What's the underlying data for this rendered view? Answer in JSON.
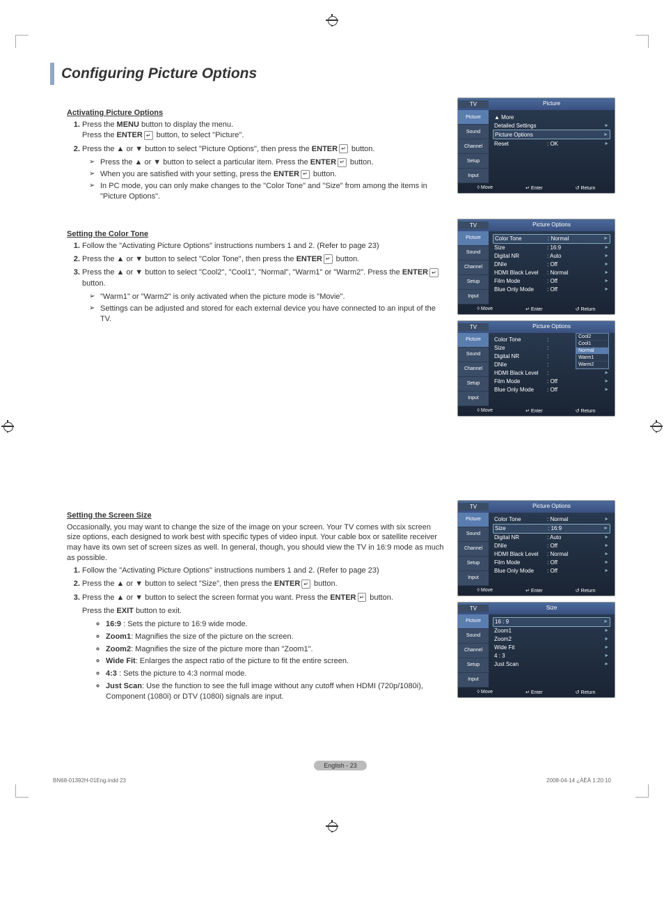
{
  "title": "Configuring Picture Options",
  "sections": {
    "s1": {
      "head": "Activating Picture Options",
      "step1a": "Press the ",
      "step1b": "MENU",
      "step1c": " button to display the menu.",
      "step1d": "Press the ",
      "step1e": "ENTER",
      "step1f": " button, to select \"Picture\".",
      "step2a": "Press the ▲ or ▼ button to select \"Picture Options\", then press the ",
      "step2b": "ENTER",
      "step2c": " button.",
      "sub1a": "Press the ▲ or ▼ button to select a particular item. Press the ",
      "sub1b": "ENTER",
      "sub1c": " button.",
      "sub2a": "When you are satisfied with your setting, press the ",
      "sub2b": "ENTER",
      "sub2c": " button.",
      "sub3": "In PC mode, you can only make changes to the \"Color Tone\" and \"Size\" from among the items in \"Picture Options\"."
    },
    "s2": {
      "head": "Setting the Color Tone",
      "step1": "Follow the \"Activating Picture Options\" instructions numbers 1 and 2. (Refer to page 23)",
      "step2a": "Press the ▲ or ▼ button to select \"Color Tone\", then press the ",
      "step2b": "ENTER",
      "step2c": " button.",
      "step3a": "Press the ▲ or ▼ button to select \"Cool2\", \"Cool1\", \"Normal\", \"Warm1\" or \"Warm2\". Press the ",
      "step3b": "ENTER",
      "step3c": " button.",
      "sub1": "\"Warm1\" or \"Warm2\" is only activated when the picture mode is \"Movie\".",
      "sub2": "Settings can be adjusted and stored for each external device you have connected to an input of the TV."
    },
    "s3": {
      "head": "Setting the Screen Size",
      "intro": "Occasionally, you may want to change the size of the image on your screen. Your TV comes with six screen size options, each designed to work best with specific types of video input. Your cable box or satellite receiver may have its own set of screen sizes as well. In general, though, you should view the TV in 16:9 mode as much as possible.",
      "step1": "Follow the \"Activating Picture Options\" instructions numbers 1 and 2. (Refer to page 23)",
      "step2a": "Press the ▲ or ▼ button to select \"Size\", then press the ",
      "step2b": "ENTER",
      "step2c": " button.",
      "step3a": "Press the ▲ or ▼ button to select the screen format you want. Press the ",
      "step3b": "ENTER",
      "step3c": " button.",
      "exit": "Press the ",
      "exitb": "EXIT",
      "exitc": " button to exit.",
      "b1": "16:9",
      "b1d": " : Sets the picture to 16:9 wide mode.",
      "b2": "Zoom1",
      "b2d": ": Magnifies the size of the picture on the screen.",
      "b3": "Zoom2",
      "b3d": ": Magnifies the size of the picture more than \"Zoom1\".",
      "b4": "Wide Fit",
      "b4d": ": Enlarges the aspect ratio of the picture to fit the entire screen.",
      "b5": "4:3",
      "b5d": " : Sets the picture to 4:3 normal mode.",
      "b6": "Just Scan",
      "b6d": ": Use the function to see the full image without any cutoff when HDMI (720p/1080i), Component (1080i) or DTV (1080i) signals are input."
    }
  },
  "osd": {
    "tv": "TV",
    "tabs": [
      "Picture",
      "Sound",
      "Channel",
      "Setup",
      "Input"
    ],
    "footer": {
      "move": "Move",
      "enter": "Enter",
      "return": "Return"
    },
    "panel1": {
      "title": "Picture",
      "more": "▲ More",
      "rows": [
        {
          "label": "Detailed Settings",
          "value": ""
        },
        {
          "label": "Picture Options",
          "value": ""
        },
        {
          "label": "Reset",
          "value": ": OK"
        }
      ]
    },
    "panel2": {
      "title": "Picture Options",
      "rows": [
        {
          "label": "Color Tone",
          "value": ": Normal"
        },
        {
          "label": "Size",
          "value": ": 16:9"
        },
        {
          "label": "Digital NR",
          "value": ": Auto"
        },
        {
          "label": "DNIe",
          "value": ": Off"
        },
        {
          "label": "HDMI Black Level",
          "value": ": Normal"
        },
        {
          "label": "Film Mode",
          "value": ": Off"
        },
        {
          "label": "Blue Only Mode",
          "value": ": Off"
        }
      ]
    },
    "panel3": {
      "title": "Picture Options",
      "rows": [
        {
          "label": "Color Tone",
          "value": ":"
        },
        {
          "label": "Size",
          "value": ":"
        },
        {
          "label": "Digital NR",
          "value": ":"
        },
        {
          "label": "DNIe",
          "value": ":"
        },
        {
          "label": "HDMI Black Level",
          "value": ":"
        },
        {
          "label": "Film Mode",
          "value": ": Off"
        },
        {
          "label": "Blue Only Mode",
          "value": ": Off"
        }
      ],
      "dropdown": [
        "Cool2",
        "Cool1",
        "Normal",
        "Warm1",
        "Warm2"
      ]
    },
    "panel4": {
      "title": "Picture Options",
      "hl": 1,
      "rows": [
        {
          "label": "Color Tone",
          "value": ": Normal"
        },
        {
          "label": "Size",
          "value": ": 16:9"
        },
        {
          "label": "Digital NR",
          "value": ": Auto"
        },
        {
          "label": "DNIe",
          "value": ": Off"
        },
        {
          "label": "HDMI Black Level",
          "value": ": Normal"
        },
        {
          "label": "Film Mode",
          "value": ": Off"
        },
        {
          "label": "Blue Only Mode",
          "value": ": Off"
        }
      ]
    },
    "panel5": {
      "title": "Size",
      "rows": [
        {
          "label": "16 : 9",
          "value": ""
        },
        {
          "label": "Zoom1",
          "value": ""
        },
        {
          "label": "Zoom2",
          "value": ""
        },
        {
          "label": "Wide Fit",
          "value": ""
        },
        {
          "label": "4 : 3",
          "value": ""
        },
        {
          "label": "Just Scan",
          "value": ""
        }
      ]
    }
  },
  "pageNumber": "English - 23",
  "footerLeft": "BN68-01392H-01Eng.indd   23",
  "footerRight": "2008-04-14   ¿ÀÈÄ 1:20:10"
}
